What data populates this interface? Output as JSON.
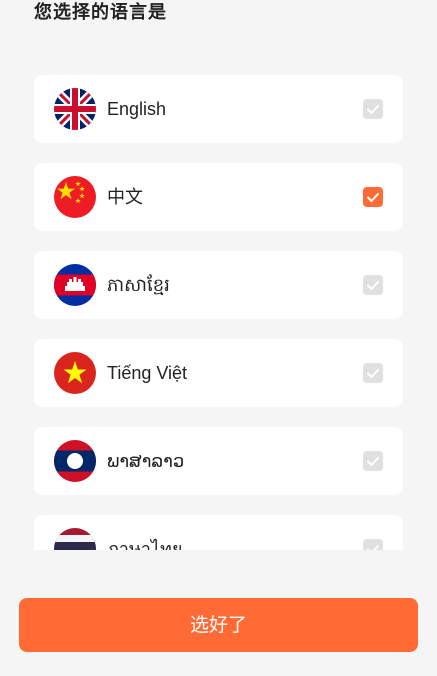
{
  "page": {
    "title": "您选择的语言是",
    "confirm_label": "选好了"
  },
  "colors": {
    "accent": "#ff6a35",
    "unchecked": "#e0e0e0",
    "card": "#ffffff",
    "background": "#f5f5f5"
  },
  "languages": [
    {
      "label": "English",
      "flag_icon": "uk-flag-icon",
      "selected": false
    },
    {
      "label": "中文",
      "flag_icon": "china-flag-icon",
      "selected": true
    },
    {
      "label": "ភាសាខ្មែរ",
      "flag_icon": "cambodia-flag-icon",
      "selected": false
    },
    {
      "label": "Tiếng Việt",
      "flag_icon": "vietnam-flag-icon",
      "selected": false
    },
    {
      "label": "ພາສາລາວ",
      "flag_icon": "laos-flag-icon",
      "selected": false
    },
    {
      "label": "ภาษาไทย",
      "flag_icon": "thailand-flag-icon",
      "selected": false
    }
  ]
}
